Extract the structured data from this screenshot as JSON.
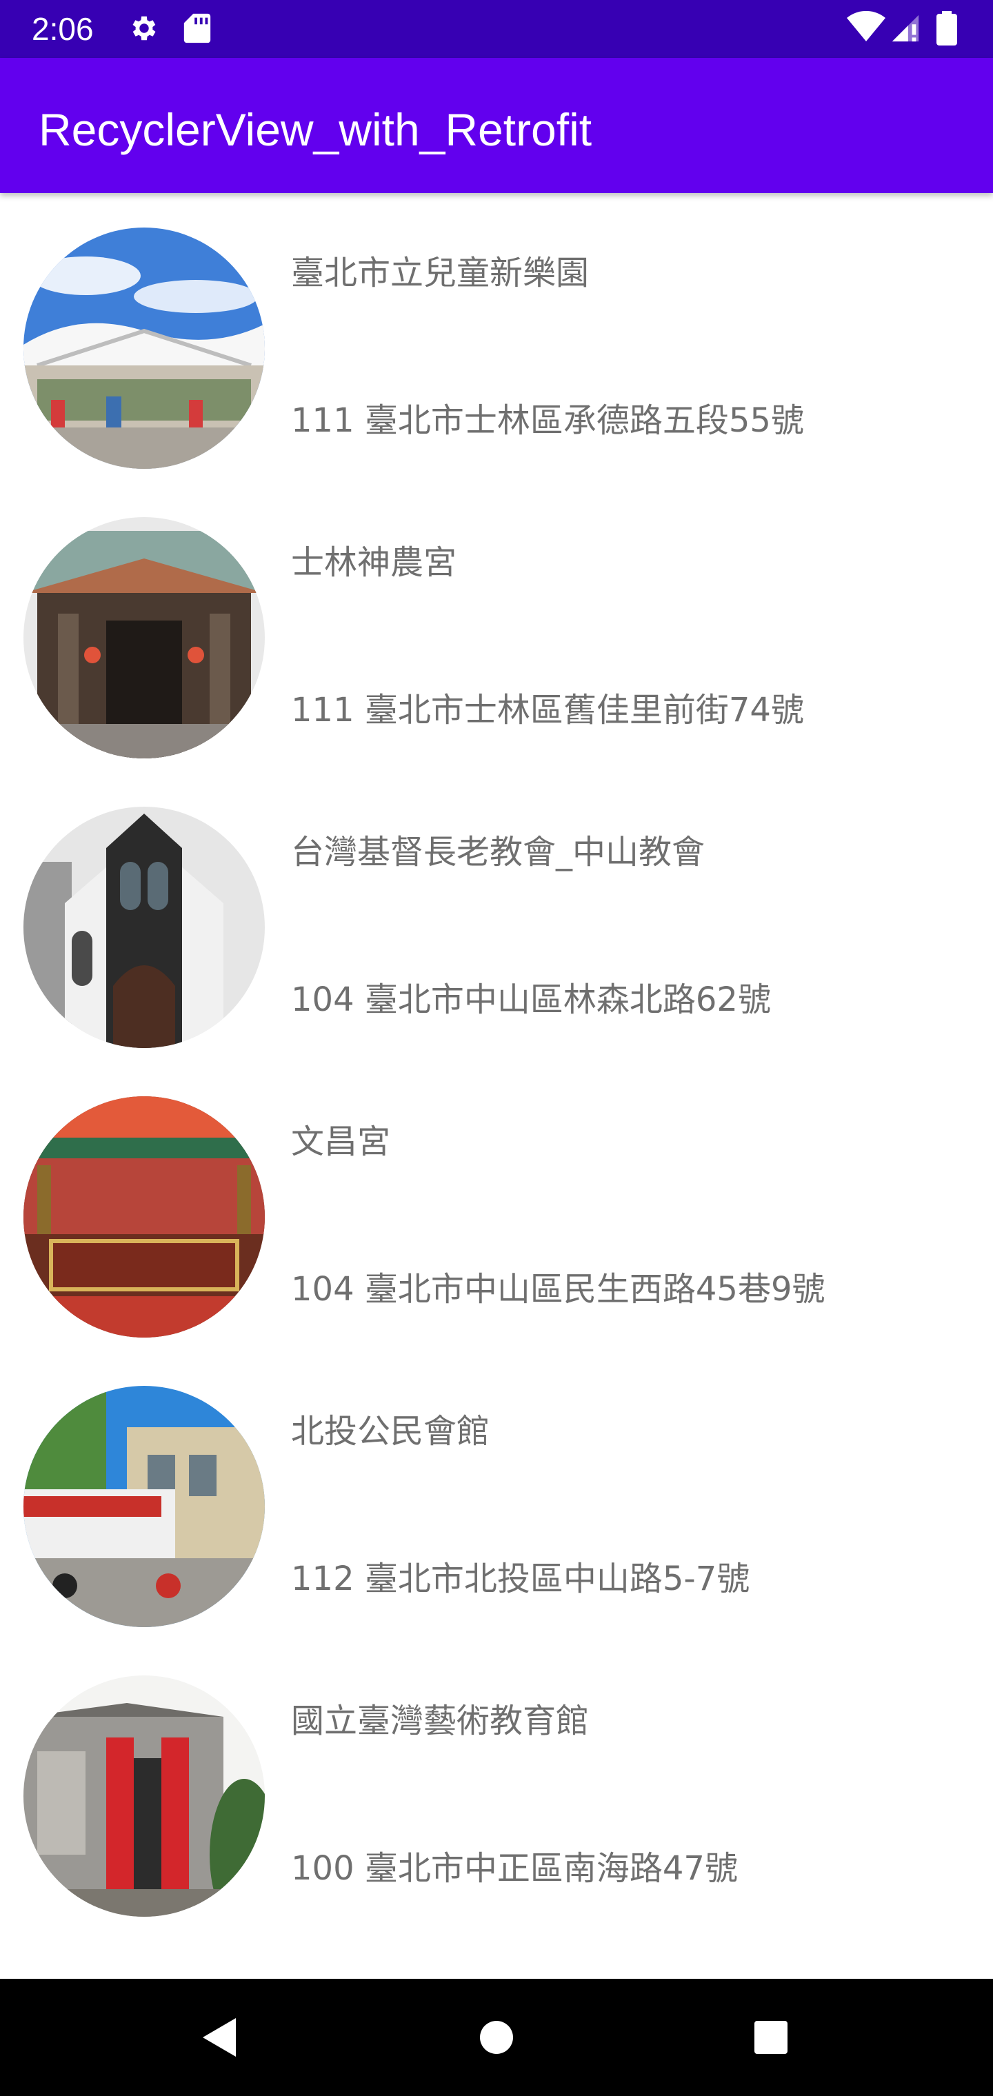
{
  "status_bar": {
    "time": "2:06",
    "icons": [
      "settings-gear-icon",
      "sd-card-icon",
      "wifi-icon",
      "cellular-signal-icon",
      "battery-icon"
    ]
  },
  "app_bar": {
    "title": "RecyclerView_with_Retrofit"
  },
  "colors": {
    "status_bar": "#3700B3",
    "app_bar": "#6200EE",
    "item_text": "#6f6f6f",
    "nav_bar": "#000000"
  },
  "items": [
    {
      "name": "臺北市立兒童新樂園",
      "address": "111 臺北市士林區承德路五段55號",
      "image": "amusement-park-photo"
    },
    {
      "name": "士林神農宮",
      "address": "111 臺北市士林區舊佳里前街74號",
      "image": "temple-photo"
    },
    {
      "name": "台灣基督長老教會_中山教會",
      "address": "104 臺北市中山區林森北路62號",
      "image": "church-photo"
    },
    {
      "name": "文昌宮",
      "address": "104 臺北市中山區民生西路45巷9號",
      "image": "temple-plaque-photo"
    },
    {
      "name": "北投公民會館",
      "address": "112 臺北市北投區中山路5-7號",
      "image": "civic-hall-photo"
    },
    {
      "name": "國立臺灣藝術教育館",
      "address": "100 臺北市中正區南海路47號",
      "image": "art-museum-photo"
    }
  ],
  "nav_bar": {
    "buttons": [
      "back-icon",
      "home-icon",
      "recents-icon"
    ]
  }
}
